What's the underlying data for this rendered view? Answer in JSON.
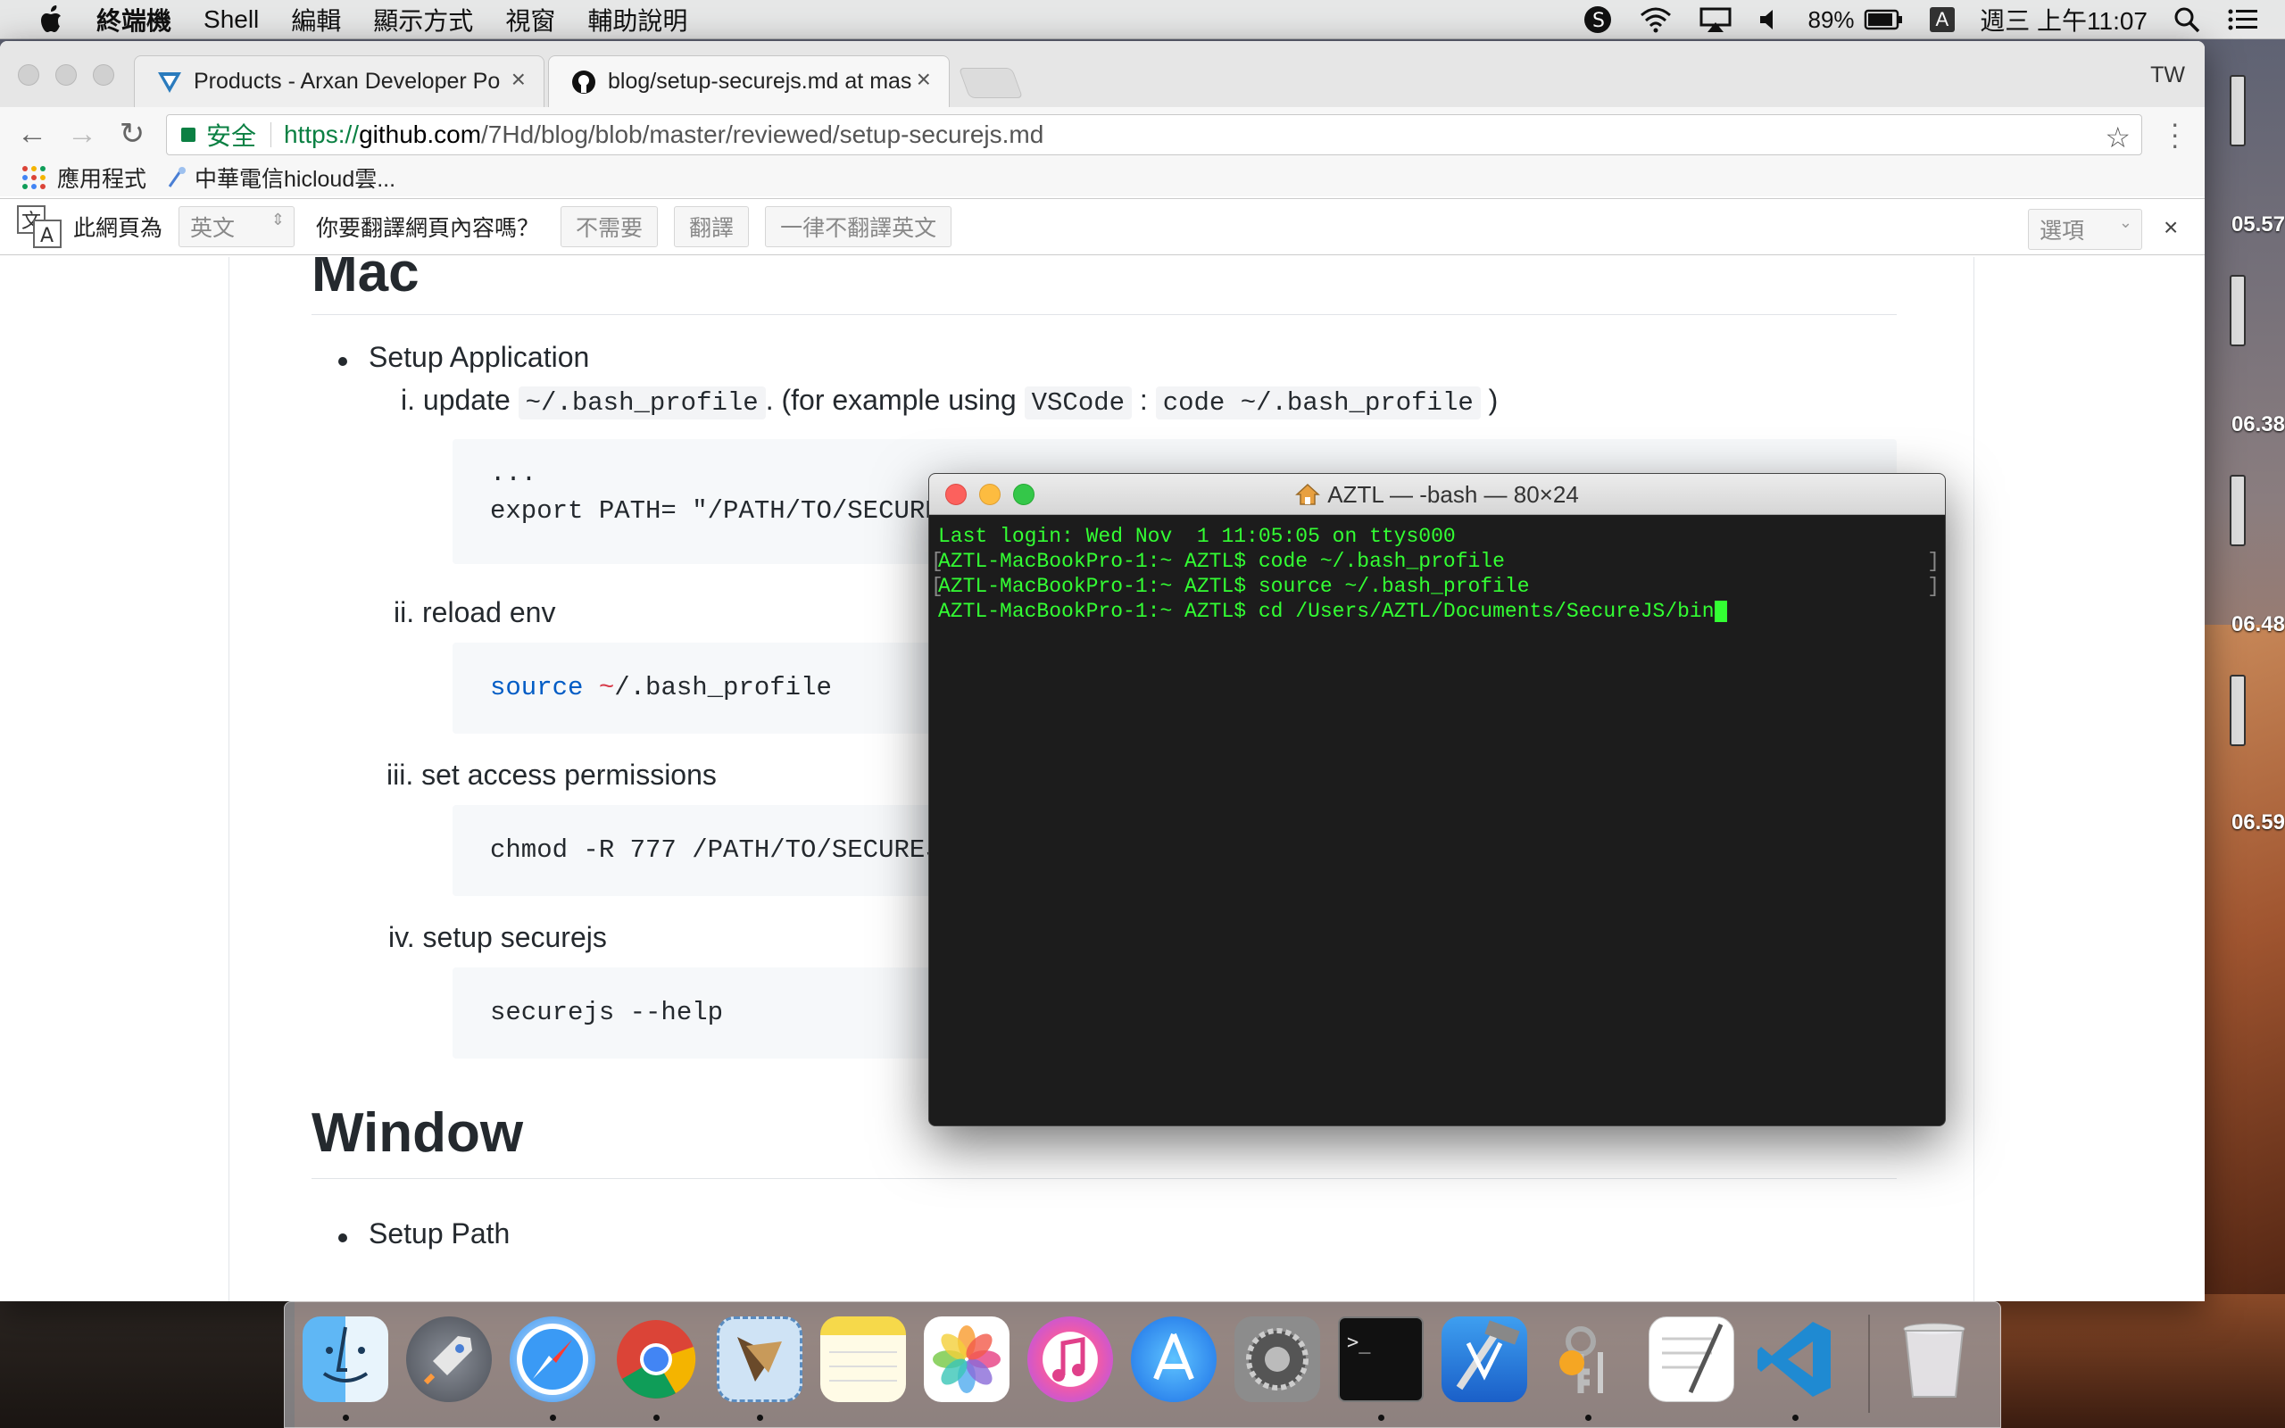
{
  "menubar": {
    "app_name": "終端機",
    "items": [
      "Shell",
      "編輯",
      "顯示方式",
      "視窗",
      "輔助說明"
    ],
    "battery": "89%",
    "input_method": "A",
    "clock": "週三 上午11:07"
  },
  "browser": {
    "tabs": [
      {
        "title": "Products - Arxan Developer Po"
      },
      {
        "title": "blog/setup-securejs.md at mas"
      }
    ],
    "profile": "TW",
    "address": {
      "secure_label": "安全",
      "scheme": "https://",
      "host": "github.com",
      "path": "/7Hd/blog/blob/master/reviewed/setup-securejs.md"
    },
    "bookmarks": [
      "應用程式",
      "中華電信hicloud雲..."
    ],
    "translate_bar": {
      "prefix": "此網頁為",
      "language": "英文",
      "question": "你要翻譯網頁內容嗎？",
      "no_button": "不需要",
      "translate_button": "翻譯",
      "never_button": "一律不翻譯英文",
      "options": "選項"
    }
  },
  "article": {
    "heading_mac": "Mac",
    "bullet_setup_app": "Setup Application",
    "step1_prefix": "i. update",
    "step1_code1": "~/.bash_profile",
    "step1_mid": ". (for example using",
    "step1_code2": "VSCode",
    "step1_colon": ":",
    "step1_code3": "code ~/.bash_profile",
    "step1_suffix": ")",
    "code1_line1": "...",
    "code1_line2": "export PATH= \"/PATH/TO/SECUREJS/b",
    "step2": "ii. reload env",
    "code2_kw": "source",
    "code2_tilde": "~",
    "code2_rest": "/.bash_profile",
    "step3": "iii. set access permissions",
    "code3": "chmod -R 777 /PATH/TO/SECUREJS/bi",
    "step4": "iv. setup securejs",
    "code4": "securejs --help",
    "heading_window": "Window",
    "bullet_setup_path": "Setup Path"
  },
  "terminal": {
    "title": "AZTL — -bash — 80×24",
    "lines": [
      "Last login: Wed Nov  1 11:05:05 on ttys000",
      "AZTL-MacBookPro-1:~ AZTL$ code ~/.bash_profile",
      "AZTL-MacBookPro-1:~ AZTL$ source ~/.bash_profile",
      "AZTL-MacBookPro-1:~ AZTL$ cd /Users/AZTL/Documents/SecureJS/bin"
    ]
  },
  "side_times": [
    "05.57",
    "06.38",
    "06.48",
    "06.59"
  ],
  "dock_apps": [
    "Finder",
    "Launchpad",
    "Safari",
    "Chrome",
    "Mail",
    "Notes",
    "Photos",
    "iTunes",
    "App Store",
    "System Preferences",
    "Terminal",
    "Xcode",
    "Keychain",
    "TextEdit",
    "VS Code",
    "Trash"
  ]
}
